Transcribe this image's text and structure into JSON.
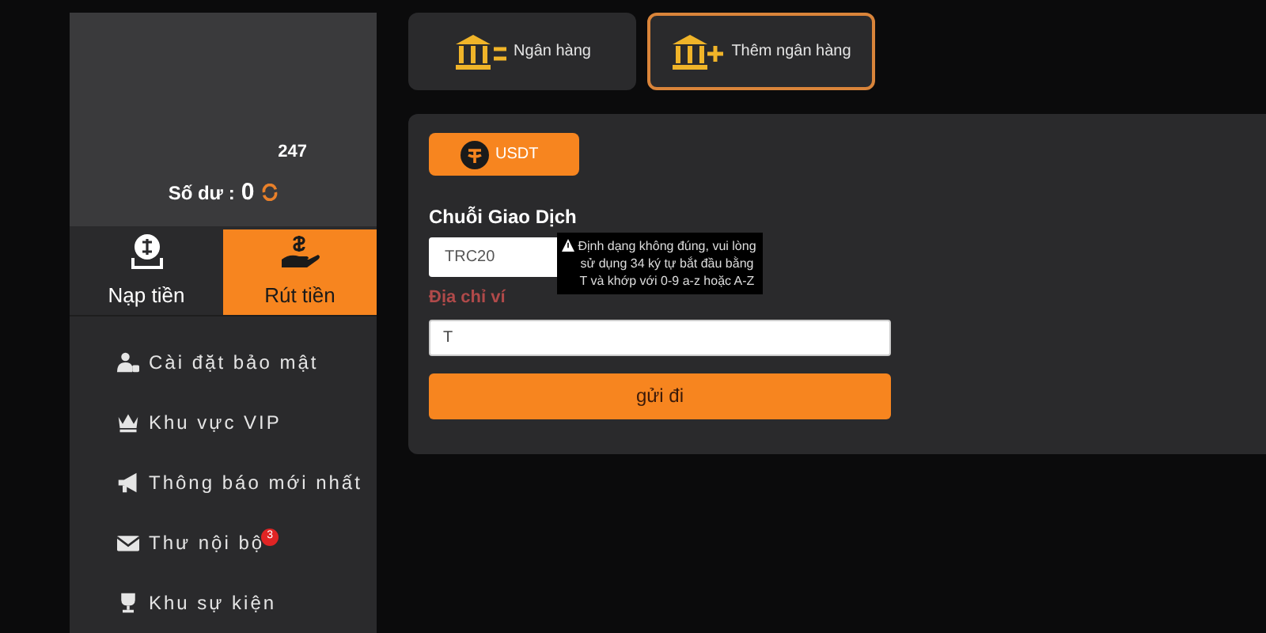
{
  "account": {
    "username_visible": "247",
    "balance_label": "Số dư :",
    "balance": "0"
  },
  "wallet_tabs": [
    {
      "label": "Nạp tiền",
      "kind": "deposit",
      "selected": false
    },
    {
      "label": "Rút tiền",
      "kind": "withdraw",
      "selected": true
    }
  ],
  "menu": [
    {
      "label": "Cài đặt bảo mật",
      "kind": "security"
    },
    {
      "label": "Khu vực VIP",
      "kind": "vip"
    },
    {
      "label": "Thông báo mới nhất",
      "kind": "news"
    },
    {
      "label": "Thư nội bộ",
      "kind": "inbox",
      "badge": "3"
    },
    {
      "label": "Khu sự kiện",
      "kind": "events"
    }
  ],
  "bank_tabs": [
    {
      "label": "Ngân hàng",
      "kind": "list",
      "selected": false
    },
    {
      "label": "Thêm ngân hàng",
      "kind": "add",
      "selected": true
    }
  ],
  "currency_button": "USDT",
  "chain_label": "Chuỗi Giao Dịch",
  "chain_value": "TRC20",
  "address_label": "Địa chỉ ví",
  "address_value": "T",
  "tooltip": "Định dạng không đúng, vui lòng sử dụng 34 ký tự bắt đầu bằng T và khớp với 0-9 a-z hoặc A-Z",
  "submit": "gửi đi"
}
